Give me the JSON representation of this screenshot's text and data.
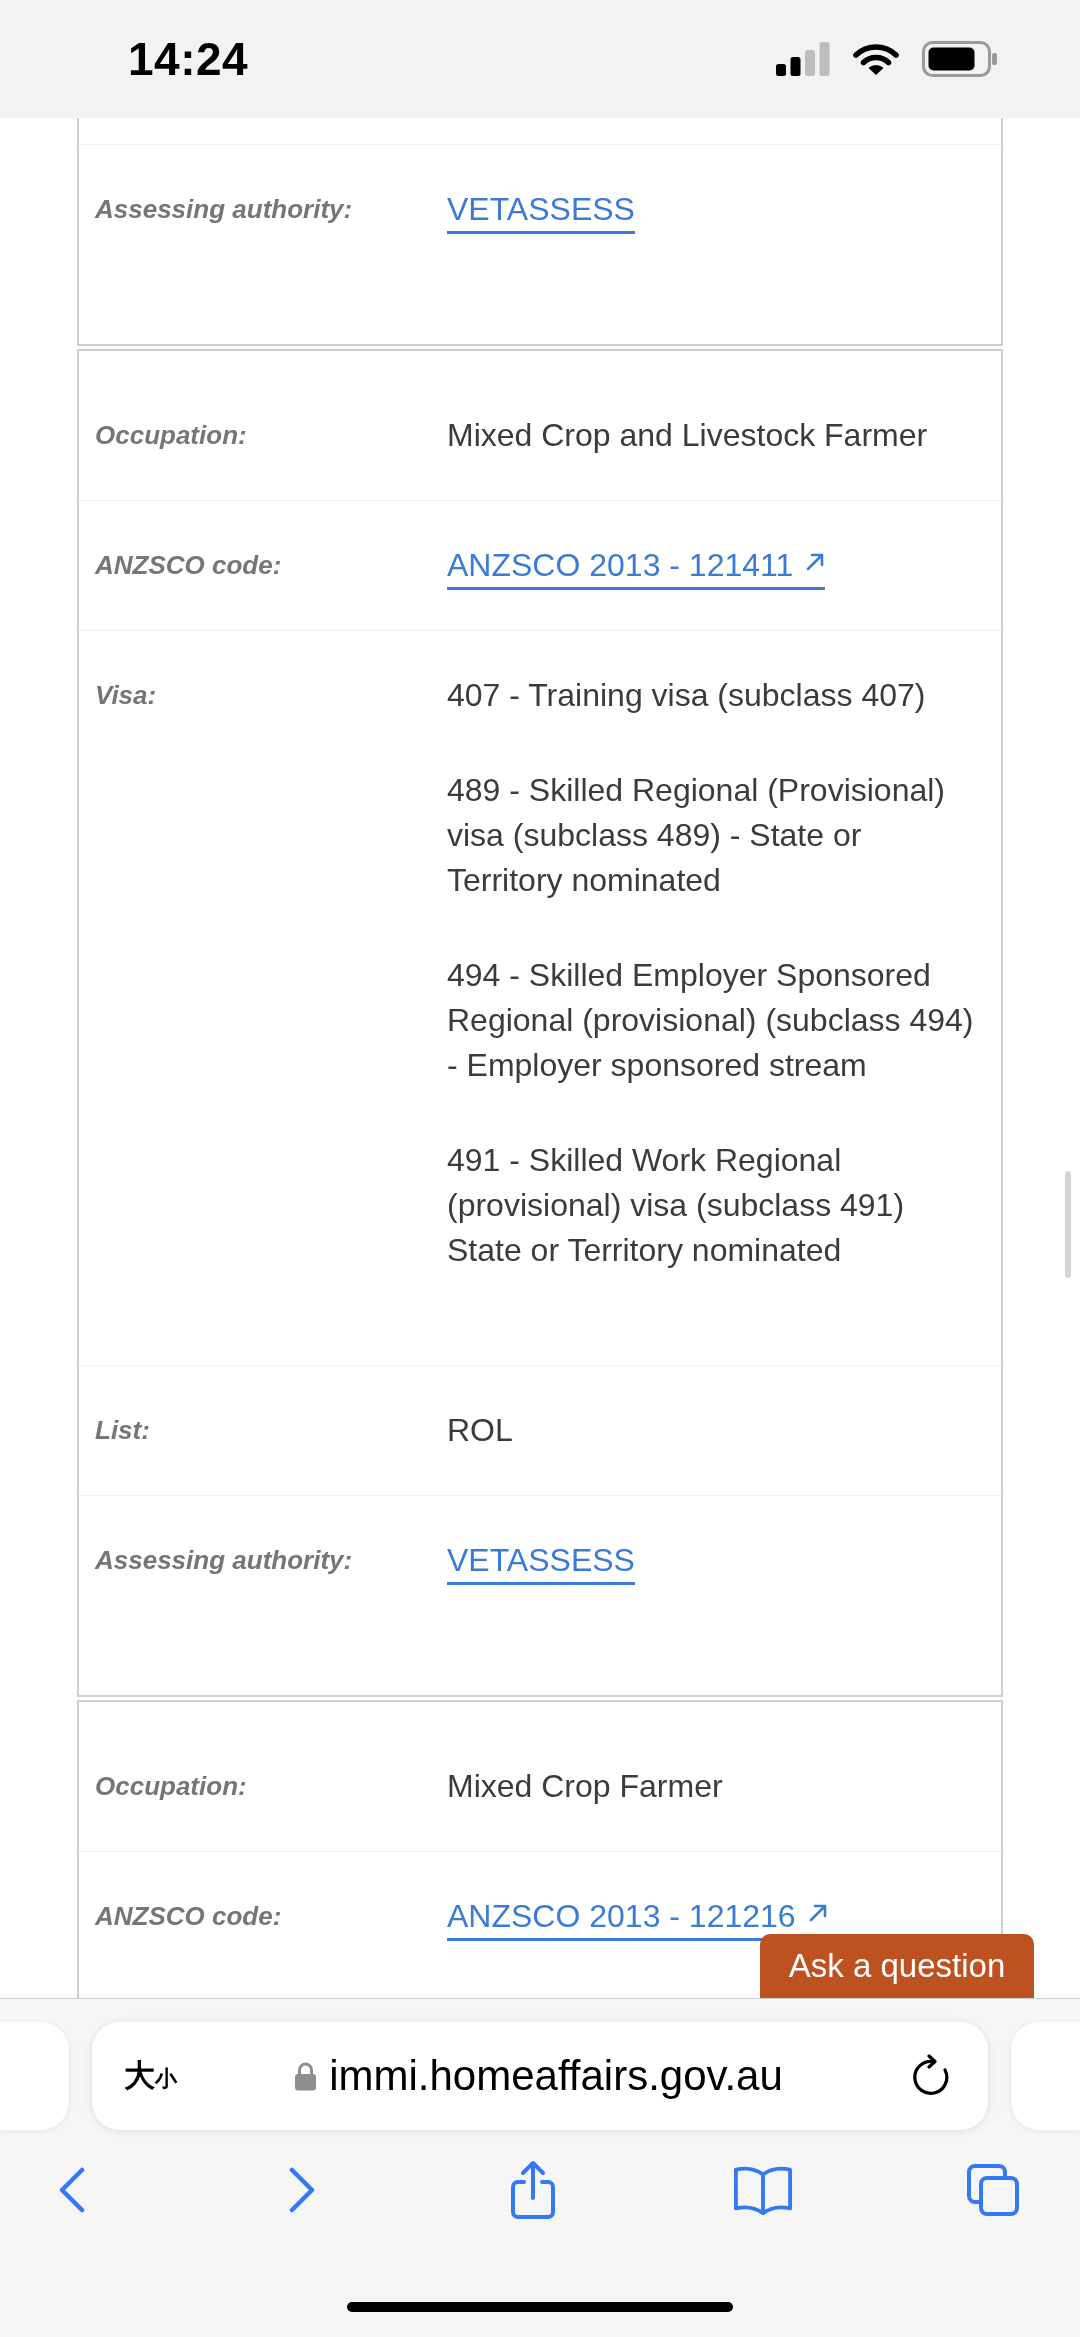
{
  "status_bar": {
    "time": "14:24"
  },
  "cards": [
    {
      "rows": [
        {
          "label": "Assessing authority:",
          "kind": "link",
          "value": "VETASSESS"
        }
      ]
    },
    {
      "rows": [
        {
          "label": "Occupation:",
          "kind": "text",
          "value": "Mixed Crop and Livestock Farmer"
        },
        {
          "label": "ANZSCO code:",
          "kind": "external_link",
          "value": "ANZSCO 2013 - 121411"
        },
        {
          "label": "Visa:",
          "kind": "list",
          "values": [
            "407 - Training visa (subclass 407)",
            "489 - Skilled Regional (Provisional) visa (subclass 489) - State or Territory nominated",
            "494 - Skilled Employer Sponsored Regional (provisional) (subclass 494) - Employer sponsored stream",
            "491 - Skilled Work Regional (provisional) visa (subclass 491) State or Territory nominated"
          ]
        },
        {
          "label": "List:",
          "kind": "text",
          "value": "ROL"
        },
        {
          "label": "Assessing authority:",
          "kind": "link",
          "value": "VETASSESS"
        }
      ]
    },
    {
      "rows": [
        {
          "label": "Occupation:",
          "kind": "text",
          "value": "Mixed Crop Farmer"
        },
        {
          "label": "ANZSCO code:",
          "kind": "external_link",
          "value": "ANZSCO 2013 - 121216"
        }
      ]
    }
  ],
  "ask_button": {
    "label": "Ask a question"
  },
  "browser": {
    "text_size_button": {
      "large": "大",
      "small": "小"
    },
    "url": "immi.homeaffairs.gov.au"
  }
}
